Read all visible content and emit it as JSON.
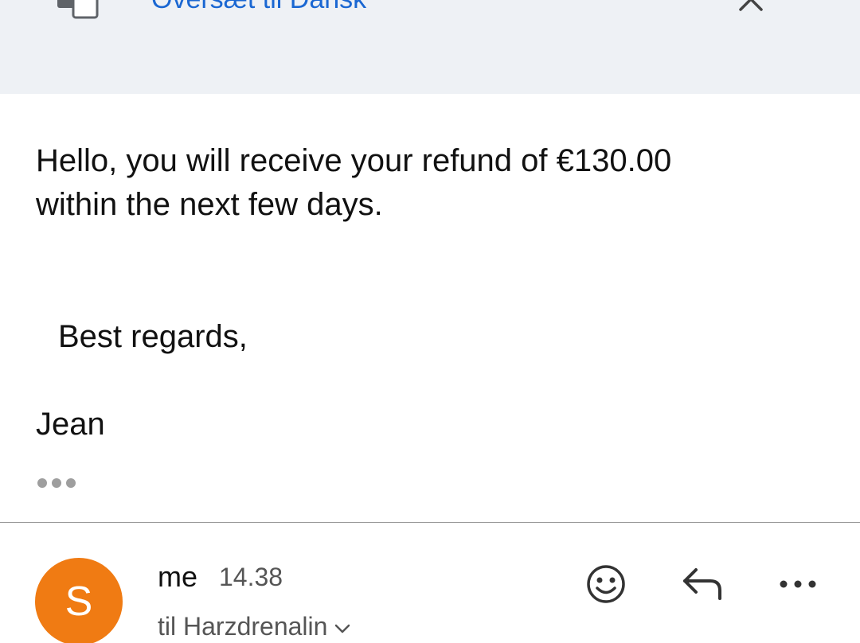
{
  "translate_bar": {
    "link_label": "Oversæt til Dansk",
    "icon": "translate-icon",
    "close_icon": "close-icon"
  },
  "message": {
    "body_line1": "Hello, you will receive your refund of €130.00\nwithin the next few days.",
    "greeting": "Best regards,",
    "signature": "Jean",
    "show_trimmed_icon": "more-horizontal-icon"
  },
  "next_message": {
    "avatar_letter": "S",
    "avatar_color": "#f07b13",
    "sender": "me",
    "time": "14.38",
    "recipients": "til Harzdrenalin",
    "actions": {
      "react_icon": "emoji-icon",
      "reply_icon": "reply-icon",
      "more_icon": "more-options-icon"
    }
  },
  "colors": {
    "link_blue": "#1a67d2",
    "banner_bg": "#eef1f5",
    "avatar_orange": "#f07b13"
  }
}
